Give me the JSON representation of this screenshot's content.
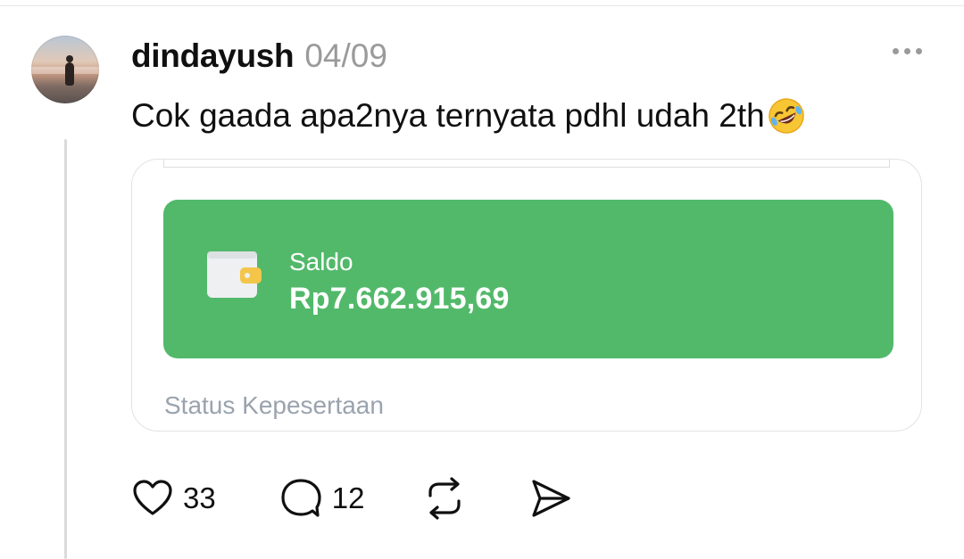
{
  "post": {
    "username": "dindayush",
    "date": "04/09",
    "text": "Cok gaada apa2nya ternyata pdhl udah 2th",
    "emoji": "rolling-on-floor-laughing-emoji"
  },
  "media": {
    "saldo_label": "Saldo",
    "saldo_value": "Rp7.662.915,69",
    "status_label": "Status Kepesertaan",
    "card_color": "#52b96a"
  },
  "actions": {
    "like_count": "33",
    "comment_count": "12"
  },
  "icons": [
    "more-icon",
    "heart-icon",
    "comment-icon",
    "repost-icon",
    "share-icon",
    "wallet-icon"
  ]
}
